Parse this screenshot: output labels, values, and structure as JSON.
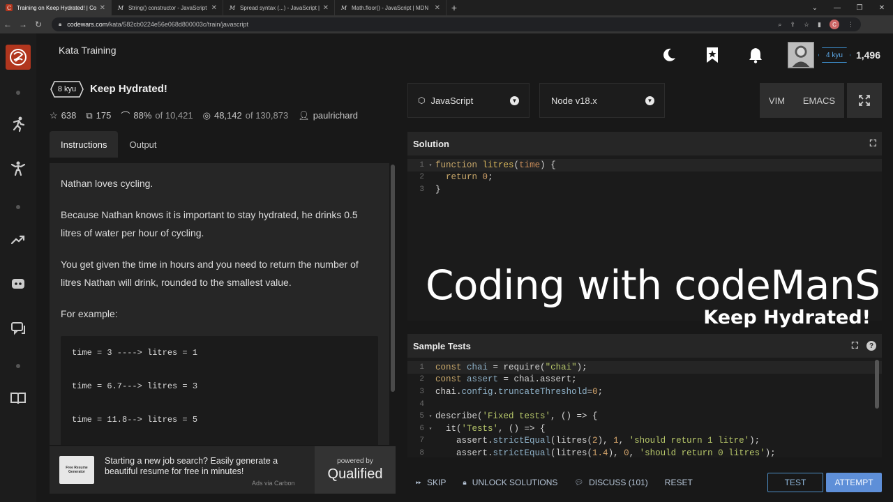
{
  "browser": {
    "tabs": [
      {
        "title": "Training on Keep Hydrated! | Co",
        "favicon": "C"
      },
      {
        "title": "String() constructor - JavaScript |",
        "favicon": "M"
      },
      {
        "title": "Spread syntax (...) - JavaScript | M",
        "favicon": "M"
      },
      {
        "title": "Math.floor() - JavaScript | MDN",
        "favicon": "M"
      }
    ],
    "url_host": "codewars.com",
    "url_path": "/kata/582cb0224e56e068d800003c/train/javascript",
    "profile_initial": "C"
  },
  "header": {
    "section": "Kata Training",
    "rank": "4 kyu",
    "honor": "1,496"
  },
  "kata": {
    "kyu": "8 kyu",
    "name": "Keep Hydrated!",
    "stars": "638",
    "collections": "175",
    "satisfaction": "88%",
    "satisfaction_of": "of 10,421",
    "completed": "48,142",
    "completed_of": "of 130,873",
    "author": "paulrichard"
  },
  "left_tabs": {
    "instructions": "Instructions",
    "output": "Output"
  },
  "description": {
    "p1": "Nathan loves cycling.",
    "p2": "Because Nathan knows it is important to stay hydrated, he drinks 0.5 litres of water per hour of cycling.",
    "p3": "You get given the time in hours and you need to return the number of litres Nathan will drink, rounded to the smallest value.",
    "p4": "For example:",
    "examples": [
      "time = 3 ----> litres = 1",
      "time = 6.7---> litres = 3",
      "time = 11.8--> litres = 5"
    ]
  },
  "ad": {
    "img_line1": "Free Resume",
    "img_line2": "Generator",
    "text": "Starting a new job search? Easily generate a beautiful resume for free in minutes!",
    "via": "Ads via Carbon",
    "powered_by": "powered by",
    "brand": "Qualified"
  },
  "editor_settings": {
    "language": "JavaScript",
    "runtime": "Node v18.x",
    "vim": "VIM",
    "emacs": "EMACS"
  },
  "solution": {
    "title": "Solution"
  },
  "sample_tests": {
    "title": "Sample Tests"
  },
  "overlay": {
    "line1": "Coding with codeManS",
    "line2": "Keep Hydrated!"
  },
  "actions": {
    "skip": "SKIP",
    "unlock": "UNLOCK SOLUTIONS",
    "discuss": "DISCUSS (101)",
    "reset": "RESET",
    "test": "TEST",
    "attempt": "ATTEMPT"
  },
  "colors": {
    "brand": "#b1361e",
    "rank_blue": "#3c8bc8",
    "attempt": "#5e8fd8"
  }
}
